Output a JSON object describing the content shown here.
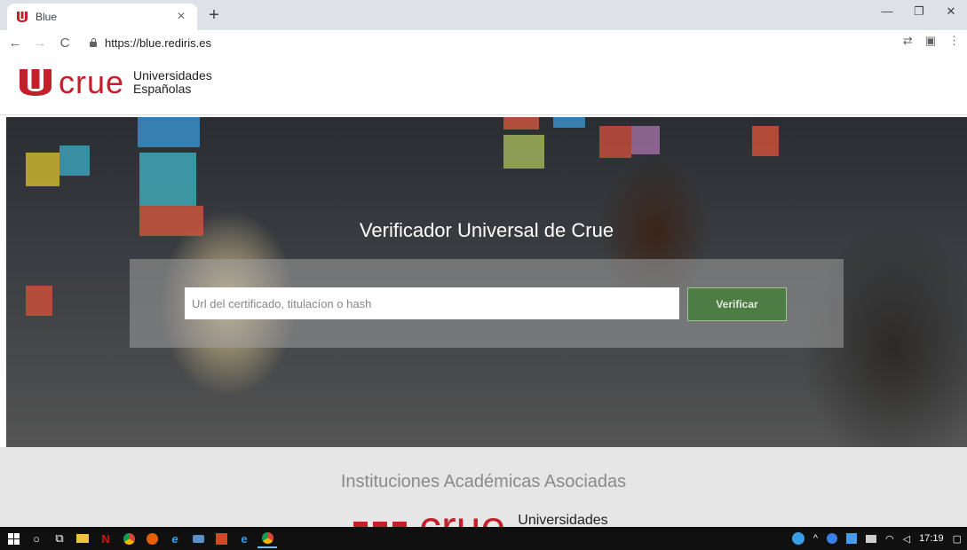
{
  "browser": {
    "tab_title": "Blue",
    "tab_close": "×",
    "new_tab": "+",
    "url": "https://blue.rediris.es",
    "window_controls": [
      "—",
      "❐",
      "✕"
    ]
  },
  "header": {
    "logo_word": "crue",
    "logo_sub_line1": "Universidades",
    "logo_sub_line2": "Españolas"
  },
  "hero": {
    "title": "Verificador Universal de Crue",
    "search_placeholder": "Url del certificado, titulacíon o hash",
    "verify_label": "Verificar"
  },
  "lower": {
    "title": "Instituciones Académicas Asociadas",
    "logo_word": "crue",
    "logo_sub_line1": "Universidades"
  },
  "taskbar": {
    "clock": "17:19"
  },
  "colors": {
    "brand_red": "#c4202b",
    "verify_green": "#4d7d45"
  }
}
